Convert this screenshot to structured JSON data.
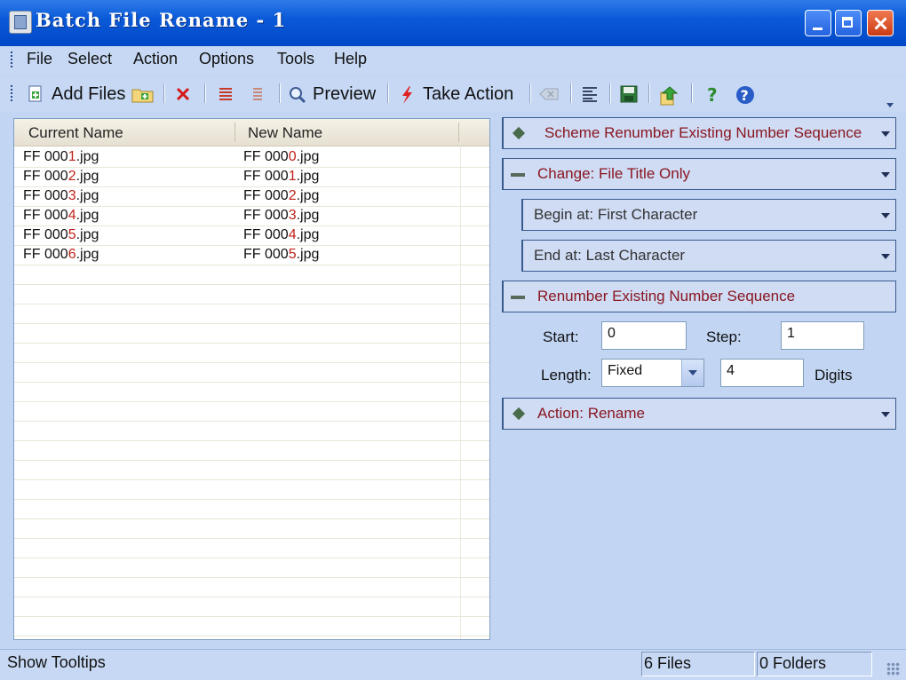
{
  "window": {
    "title": "Batch File Rename - 1"
  },
  "menu": [
    "File",
    "Select",
    "Action",
    "Options",
    "Tools",
    "Help"
  ],
  "toolbar": {
    "add_files": "Add Files",
    "preview": "Preview",
    "take_action": "Take Action"
  },
  "list": {
    "col_current": "Current Name",
    "col_new": "New Name",
    "rows": [
      {
        "cur_pre": "FF 000",
        "cur_hl": "1",
        "cur_post": ".jpg",
        "new_pre": "FF 000",
        "new_hl": "0",
        "new_post": ".jpg"
      },
      {
        "cur_pre": "FF 000",
        "cur_hl": "2",
        "cur_post": ".jpg",
        "new_pre": "FF 000",
        "new_hl": "1",
        "new_post": ".jpg"
      },
      {
        "cur_pre": "FF 000",
        "cur_hl": "3",
        "cur_post": ".jpg",
        "new_pre": "FF 000",
        "new_hl": "2",
        "new_post": ".jpg"
      },
      {
        "cur_pre": "FF 000",
        "cur_hl": "4",
        "cur_post": ".jpg",
        "new_pre": "FF 000",
        "new_hl": "3",
        "new_post": ".jpg"
      },
      {
        "cur_pre": "FF 000",
        "cur_hl": "5",
        "cur_post": ".jpg",
        "new_pre": "FF 000",
        "new_hl": "4",
        "new_post": ".jpg"
      },
      {
        "cur_pre": "FF 000",
        "cur_hl": "6",
        "cur_post": ".jpg",
        "new_pre": "FF 000",
        "new_hl": "5",
        "new_post": ".jpg"
      }
    ]
  },
  "panel": {
    "scheme": "Scheme  Renumber Existing Number Sequence",
    "change": "Change: File Title Only",
    "begin": "Begin at: First Character",
    "end": "End at: Last Character",
    "renumber": "Renumber Existing Number Sequence",
    "start_label": "Start:",
    "start_value": "0",
    "step_label": "Step:",
    "step_value": "1",
    "length_label": "Length:",
    "length_value": "Fixed",
    "digits_value": "4",
    "digits_label": "Digits",
    "action": "Action: Rename"
  },
  "status": {
    "tooltips": "Show Tooltips",
    "files": "6 Files",
    "folders": "0 Folders"
  },
  "colors": {
    "title_blue": "#0a5ad8",
    "highlight_red": "#c0221a",
    "section_text": "#8a1620"
  }
}
